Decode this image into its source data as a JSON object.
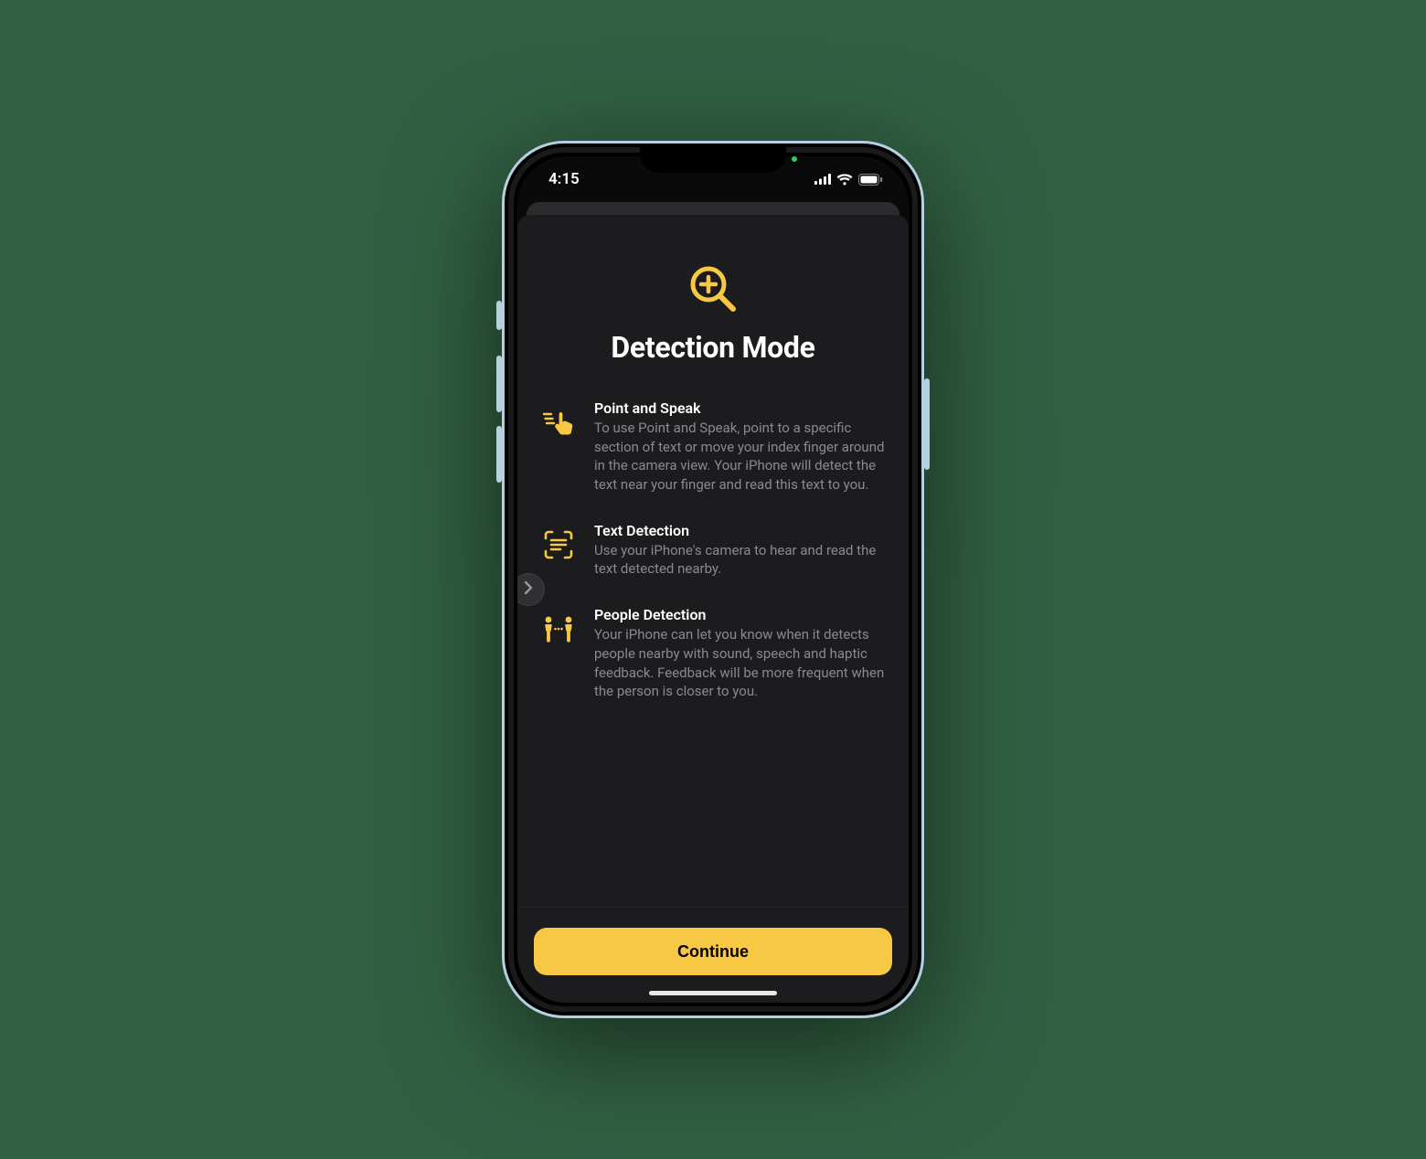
{
  "statusbar": {
    "time": "4:15"
  },
  "sheet": {
    "title": "Detection Mode",
    "hero_icon": "magnifier-plus-icon",
    "features": [
      {
        "icon": "point-speak-icon",
        "title": "Point and Speak",
        "desc": "To use Point and Speak, point to a specific section of text or move your index finger around in the camera view. Your iPhone will detect the text near your finger and read this text to you."
      },
      {
        "icon": "text-detection-icon",
        "title": "Text Detection",
        "desc": "Use your iPhone's camera to hear and read the text detected nearby."
      },
      {
        "icon": "people-detection-icon",
        "title": "People Detection",
        "desc": "Your iPhone can let you know when it detects people nearby with sound, speech and haptic feedback. Feedback will be more frequent when the person is closer to you."
      }
    ],
    "cta_label": "Continue"
  },
  "colors": {
    "accent": "#f6c844",
    "background": "#1c1c1e",
    "text_primary": "#ffffff",
    "text_secondary": "#8a8a8e"
  }
}
